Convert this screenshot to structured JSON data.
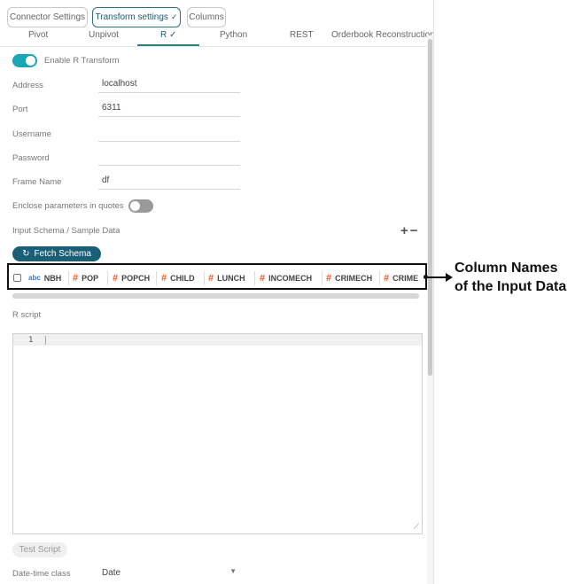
{
  "top_tabs": [
    {
      "label": "Connector Settings"
    },
    {
      "label": "Transform settings",
      "check": "✓"
    },
    {
      "label": "Columns"
    }
  ],
  "sub_tabs": [
    {
      "label": "Pivot"
    },
    {
      "label": "Unpivot"
    },
    {
      "label": "R ✓"
    },
    {
      "label": "Python"
    },
    {
      "label": "REST"
    },
    {
      "label": "Orderbook Reconstruction"
    }
  ],
  "enable_r": {
    "label": "Enable R Transform",
    "on": true
  },
  "fields": {
    "address": {
      "label": "Address",
      "value": "localhost"
    },
    "port": {
      "label": "Port",
      "value": "6311"
    },
    "username": {
      "label": "Username",
      "value": ""
    },
    "password": {
      "label": "Password",
      "value": ""
    },
    "frame_name": {
      "label": "Frame Name",
      "value": "df"
    }
  },
  "enclose_params": {
    "label": "Enclose parameters in quotes",
    "on": false
  },
  "input_schema": {
    "label": "Input Schema / Sample Data",
    "plus_minus": "+−"
  },
  "fetch_schema": {
    "label": "Fetch Schema",
    "icon": "↻"
  },
  "columns": [
    {
      "type": "abc",
      "name": "NBH"
    },
    {
      "type": "#",
      "name": "POP"
    },
    {
      "type": "#",
      "name": "POPCH"
    },
    {
      "type": "#",
      "name": "CHILD"
    },
    {
      "type": "#",
      "name": "LUNCH"
    },
    {
      "type": "#",
      "name": "INCOMECH"
    },
    {
      "type": "#",
      "name": "CRIMECH"
    },
    {
      "type": "#",
      "name": "CRIME"
    }
  ],
  "callout": {
    "line1": "Column Names",
    "line2": "of the Input Data"
  },
  "r_script": {
    "label": "R script",
    "line_number": "1"
  },
  "test_script": {
    "label": "Test Script"
  },
  "datetime_class": {
    "label": "Date-time class",
    "value": "Date"
  },
  "colors": {
    "accent": "#1aa6b7",
    "button": "#1b5f77",
    "numeric_type": "#f05a28",
    "text_type": "#3a7bd5"
  }
}
